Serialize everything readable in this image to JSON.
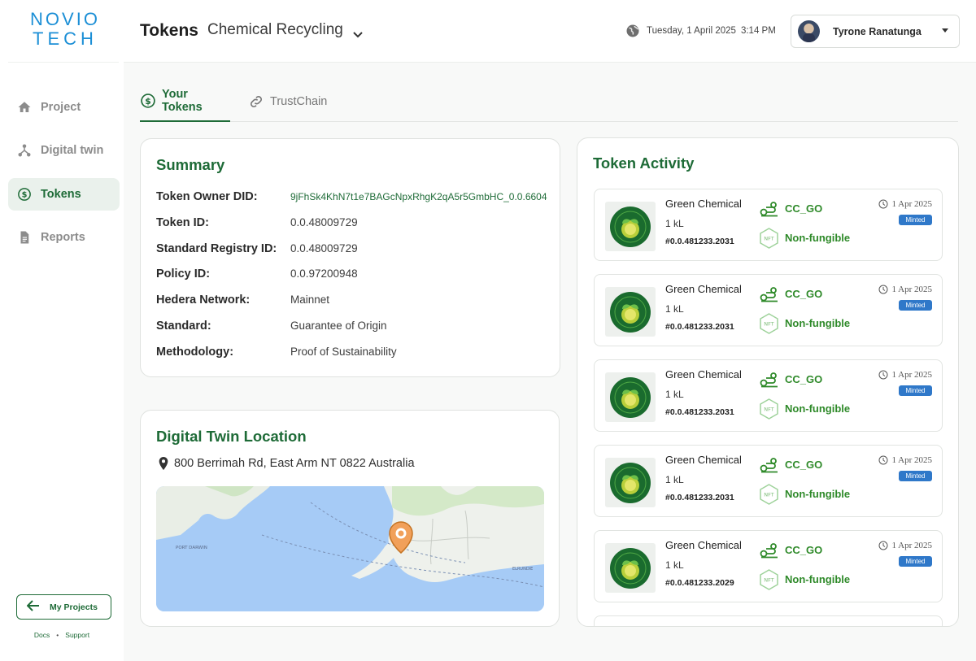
{
  "brand": {
    "logo_line1": "NOVIO",
    "logo_line2": "TECH"
  },
  "sidebar": {
    "items": [
      {
        "label": "Project",
        "icon": "home-icon"
      },
      {
        "label": "Digital twin",
        "icon": "graph-icon"
      },
      {
        "label": "Tokens",
        "icon": "dollar-circle-icon",
        "active": true
      },
      {
        "label": "Reports",
        "icon": "document-icon"
      }
    ],
    "my_projects_label": "My Projects",
    "footer": {
      "docs": "Docs",
      "dot": "•",
      "support": "Support"
    }
  },
  "header": {
    "title": "Tokens",
    "project": "Chemical Recycling",
    "date": "Tuesday, 1 April 2025",
    "time": "3:14 PM",
    "user_name": "Tyrone Ranatunga"
  },
  "tabs": [
    {
      "label": "Your Tokens",
      "active": true
    },
    {
      "label": "TrustChain",
      "active": false
    }
  ],
  "summary": {
    "title": "Summary",
    "rows": [
      {
        "label": "Token Owner DID:",
        "value": "9jFhSk4KhN7t1e7BAGcNpxRhgK2qA5r5GmbHC_0.0.6604"
      },
      {
        "label": "Token ID:",
        "value": "0.0.48009729"
      },
      {
        "label": "Standard Registry ID:",
        "value": "0.0.48009729"
      },
      {
        "label": "Policy ID:",
        "value": "0.0.97200948"
      },
      {
        "label": "Hedera Network:",
        "value": "Mainnet"
      },
      {
        "label": "Standard:",
        "value": "Guarantee of Origin"
      },
      {
        "label": "Methodology:",
        "value": "Proof of Sustainability"
      }
    ]
  },
  "location": {
    "title": "Digital Twin Location",
    "address": "800 Berrimah Rd, East Arm NT 0822 Australia",
    "map_labels": {
      "left": "PORT DARWIN",
      "right": "ELRUNDIE"
    }
  },
  "activity": {
    "title": "Token Activity",
    "items": [
      {
        "name": "Green Chemical",
        "qty": "1 kL",
        "serial": "#0.0.481233.2031",
        "code": "CC_GO",
        "type": "Non-fungible",
        "date": "1 Apr 2025",
        "status": "Minted"
      },
      {
        "name": "Green Chemical",
        "qty": "1 kL",
        "serial": "#0.0.481233.2031",
        "code": "CC_GO",
        "type": "Non-fungible",
        "date": "1 Apr 2025",
        "status": "Minted"
      },
      {
        "name": "Green Chemical",
        "qty": "1 kL",
        "serial": "#0.0.481233.2031",
        "code": "CC_GO",
        "type": "Non-fungible",
        "date": "1 Apr 2025",
        "status": "Minted"
      },
      {
        "name": "Green Chemical",
        "qty": "1 kL",
        "serial": "#0.0.481233.2031",
        "code": "CC_GO",
        "type": "Non-fungible",
        "date": "1 Apr 2025",
        "status": "Minted"
      },
      {
        "name": "Green Chemical",
        "qty": "1 kL",
        "serial": "#0.0.481233.2029",
        "code": "CC_GO",
        "type": "Non-fungible",
        "date": "1 Apr 2025",
        "status": "Minted"
      }
    ]
  },
  "colors": {
    "brand_green": "#1e6b37",
    "token_green": "#2f8a2a",
    "logo_blue": "#1c8fd6",
    "badge_blue": "#2f78c9",
    "map_water": "#a6cbf6"
  }
}
